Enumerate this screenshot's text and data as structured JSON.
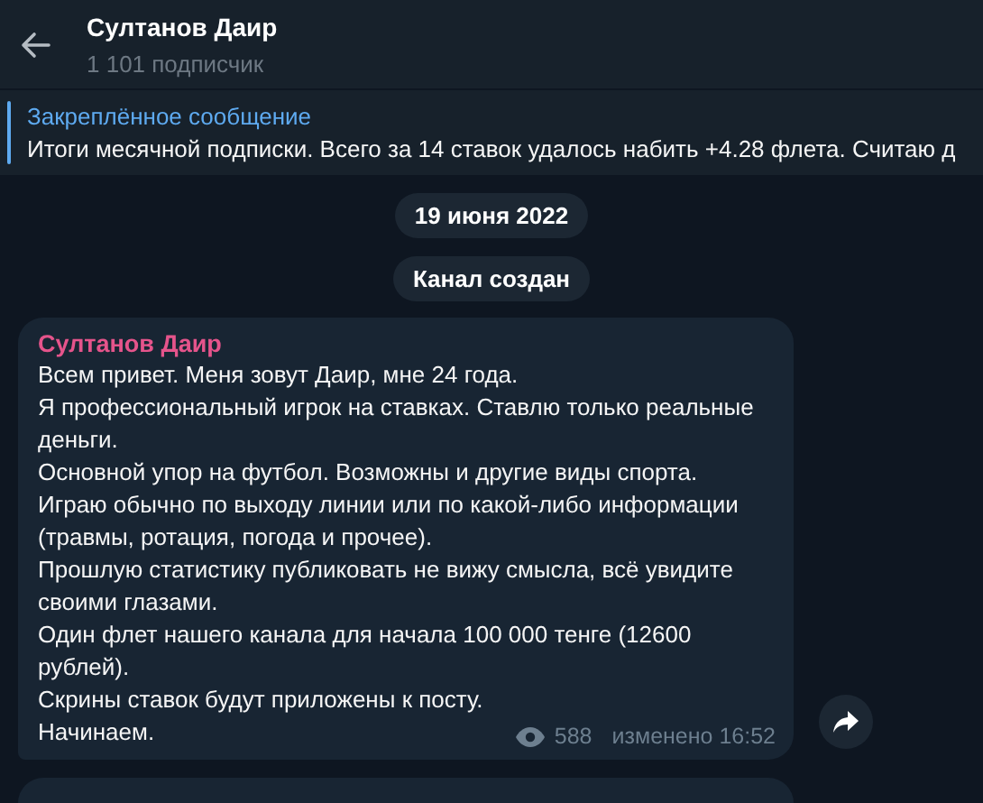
{
  "header": {
    "title": "Султанов Даир",
    "subtitle": "1 101 подписчик"
  },
  "pinned": {
    "label": "Закреплённое сообщение",
    "text": "Итоги месячной подписки. Всего за 14 ставок удалось набить +4.28 флета. Считаю д"
  },
  "service_messages": [
    "19 июня 2022",
    "Канал создан"
  ],
  "message": {
    "author": "Султанов Даир",
    "paragraphs": [
      "Всем привет. Меня зовут Даир, мне 24 года.",
      "Я профессиональный игрок на ставках. Ставлю только реальные деньги.",
      "Основной упор на футбол. Возможны и другие виды спорта.",
      "Играю обычно по выходу линии или по какой-либо информации (травмы, ротация, погода и прочее).",
      "Прошлую статистику публиковать не вижу смысла, всё увидите своими глазами.",
      "Один флет нашего канала для начала 100 000 тенге (12600 рублей).",
      "Скрины ставок будут приложены к посту.",
      "Начинаем."
    ],
    "views": "588",
    "time": "изменено 16:52"
  }
}
